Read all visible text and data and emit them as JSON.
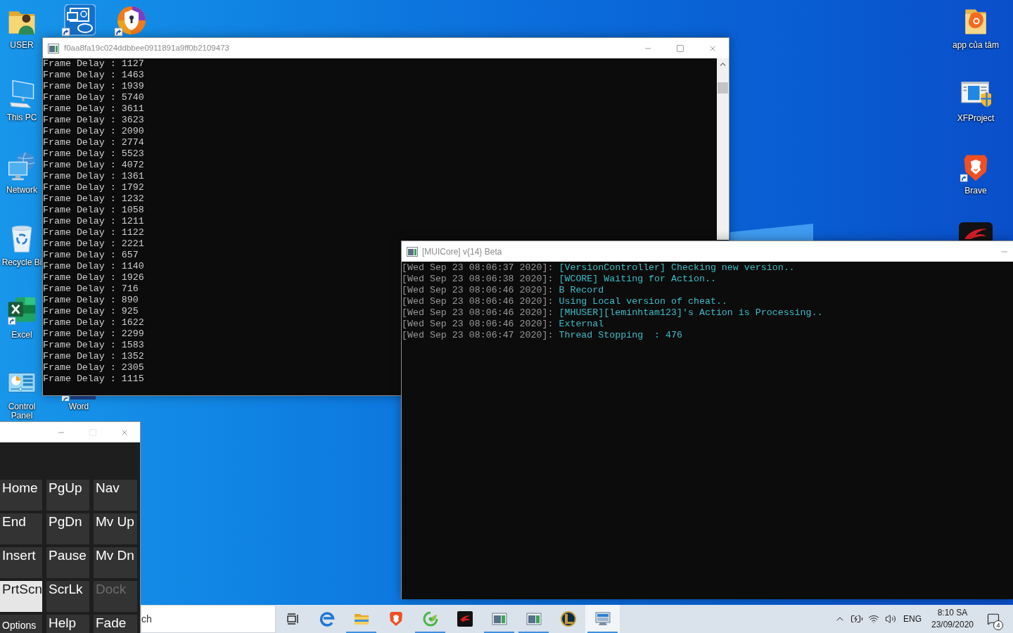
{
  "desktop": {
    "left_icons": [
      {
        "label": "USER",
        "kind": "user"
      },
      {
        "label": "This PC",
        "kind": "pc"
      },
      {
        "label": "Network",
        "kind": "network"
      },
      {
        "label": "Recycle Bi",
        "kind": "recycle"
      },
      {
        "label": "Excel",
        "kind": "excel"
      },
      {
        "label": "Control Panel",
        "kind": "control-panel"
      },
      {
        "label": "Word",
        "kind": "word"
      }
    ],
    "right_icons": [
      {
        "label": "app của tâm",
        "kind": "folder"
      },
      {
        "label": "XFProject",
        "kind": "xfproject"
      },
      {
        "label": "Brave",
        "kind": "brave"
      }
    ]
  },
  "console_window": {
    "title": "f0aa8fa19c024ddbbee0911891a9ff0b2109473",
    "lines": [
      "Frame Delay : 1127",
      "Frame Delay : 1463",
      "Frame Delay : 1939",
      "Frame Delay : 5740",
      "Frame Delay : 3611",
      "Frame Delay : 3623",
      "Frame Delay : 2090",
      "Frame Delay : 2774",
      "Frame Delay : 5523",
      "Frame Delay : 4072",
      "Frame Delay : 1361",
      "Frame Delay : 1792",
      "Frame Delay : 1232",
      "Frame Delay : 1058",
      "Frame Delay : 1211",
      "Frame Delay : 1122",
      "Frame Delay : 2221",
      "Frame Delay : 657",
      "Frame Delay : 1140",
      "Frame Delay : 1926",
      "Frame Delay : 716",
      "Frame Delay : 890",
      "Frame Delay : 925",
      "Frame Delay : 1622",
      "Frame Delay : 2299",
      "Frame Delay : 1583",
      "Frame Delay : 1352",
      "Frame Delay : 2305",
      "Frame Delay : 1115"
    ]
  },
  "log_window": {
    "title": "[MUICore] v{14} Beta",
    "lines": [
      {
        "timestamp": "[Wed Sep 23 08:06:37 2020]:",
        "message": "[VersionController] Checking new version.."
      },
      {
        "timestamp": "[Wed Sep 23 08:06:38 2020]:",
        "message": "[WCORE] Waiting for Action.."
      },
      {
        "timestamp": "[Wed Sep 23 08:06:46 2020]:",
        "message": "B Record"
      },
      {
        "timestamp": "[Wed Sep 23 08:06:46 2020]:",
        "message": "Using Local version of cheat.."
      },
      {
        "timestamp": "[Wed Sep 23 08:06:46 2020]:",
        "message": "[MHUSER][leminhtam123]'s Action is Processing.."
      },
      {
        "timestamp": "[Wed Sep 23 08:06:46 2020]:",
        "message": "External"
      },
      {
        "timestamp": "[Wed Sep 23 08:06:47 2020]:",
        "message": "Thread Stopping  : 476"
      }
    ]
  },
  "keypad_window": {
    "keys": [
      {
        "label": "Home",
        "kind": "regular",
        "pressed": false,
        "disabled": false
      },
      {
        "label": "PgUp",
        "kind": "regular",
        "pressed": false,
        "disabled": false
      },
      {
        "label": "Nav",
        "kind": "regular",
        "pressed": false,
        "disabled": false
      },
      {
        "label": "End",
        "kind": "regular",
        "pressed": false,
        "disabled": false
      },
      {
        "label": "PgDn",
        "kind": "regular",
        "pressed": false,
        "disabled": false
      },
      {
        "label": "Mv Up",
        "kind": "regular",
        "pressed": false,
        "disabled": false
      },
      {
        "label": "Insert",
        "kind": "regular",
        "pressed": false,
        "disabled": false
      },
      {
        "label": "Pause",
        "kind": "regular",
        "pressed": false,
        "disabled": false
      },
      {
        "label": "Mv Dn",
        "kind": "regular",
        "pressed": false,
        "disabled": false
      },
      {
        "label": "PrtScn",
        "kind": "regular",
        "pressed": true,
        "disabled": false
      },
      {
        "label": "ScrLk",
        "kind": "regular",
        "pressed": false,
        "disabled": false
      },
      {
        "label": "Dock",
        "kind": "regular",
        "pressed": false,
        "disabled": true
      },
      {
        "label": "Options",
        "kind": "small",
        "pressed": false,
        "disabled": false
      },
      {
        "label": "Help",
        "kind": "regular",
        "pressed": false,
        "disabled": false
      },
      {
        "label": "Fade",
        "kind": "regular",
        "pressed": false,
        "disabled": false
      }
    ]
  },
  "taskbar": {
    "search": {
      "placeholder": "ch"
    },
    "apps": [
      {
        "kind": "edge",
        "running": false,
        "selected": false
      },
      {
        "kind": "explorer",
        "running": true,
        "selected": false
      },
      {
        "kind": "brave",
        "running": false,
        "selected": false
      },
      {
        "kind": "green",
        "running": true,
        "selected": false
      },
      {
        "kind": "garena",
        "running": false,
        "selected": false
      },
      {
        "kind": "console",
        "running": true,
        "selected": false
      },
      {
        "kind": "console",
        "running": true,
        "selected": false
      },
      {
        "kind": "league",
        "running": false,
        "selected": false
      },
      {
        "kind": "monitor",
        "running": true,
        "selected": true
      }
    ],
    "tray": {
      "language": "ENG",
      "time": "8:10 SA",
      "date": "23/09/2020",
      "notification_count": "4"
    }
  }
}
